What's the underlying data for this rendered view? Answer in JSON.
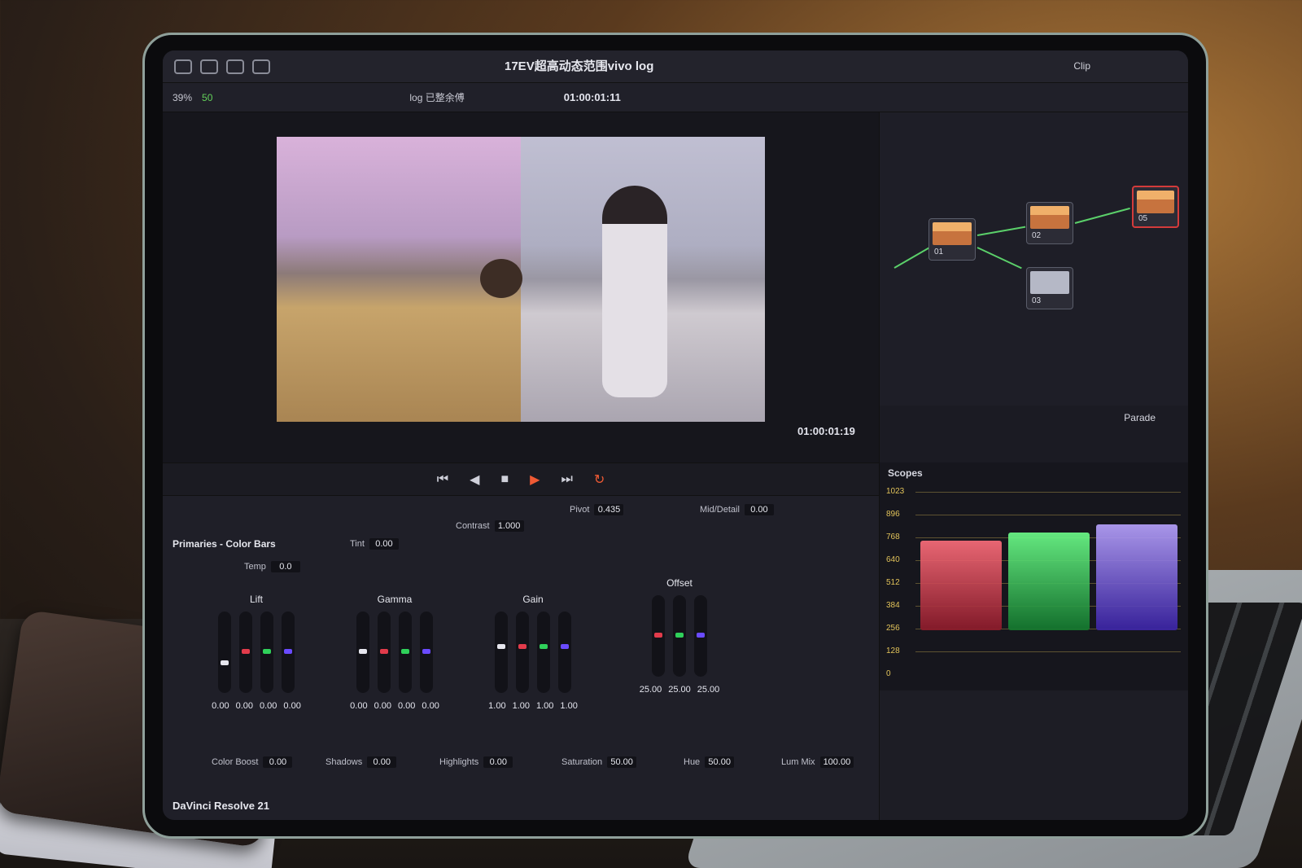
{
  "app": {
    "title": "17EV超高动态范围vivo log",
    "clip_menu": "Clip",
    "brand": "DaVinci Resolve 21"
  },
  "viewer": {
    "zoom": "39%",
    "field_value": "50",
    "clip_name": "log 已整余傅",
    "timecode_top": "01:00:01:11",
    "timecode_bottom": "01:00:01:19"
  },
  "nodes": {
    "items": [
      {
        "label": "01"
      },
      {
        "label": "02"
      },
      {
        "label": "03"
      },
      {
        "label": "05"
      }
    ],
    "scope_mode": "Parade"
  },
  "scopes": {
    "title": "Scopes",
    "scale": [
      "1023",
      "896",
      "768",
      "640",
      "512",
      "384",
      "256",
      "128",
      "0"
    ]
  },
  "primaries": {
    "title": "Primaries - Color Bars",
    "temp_label": "Temp",
    "temp": "0.0",
    "tint_label": "Tint",
    "tint": "0.00",
    "contrast_label": "Contrast",
    "contrast": "1.000",
    "pivot_label": "Pivot",
    "pivot": "0.435",
    "middetail_label": "Mid/Detail",
    "middetail": "0.00",
    "lift": {
      "title": "Lift",
      "values": [
        "0.00",
        "0.00",
        "0.00",
        "0.00"
      ]
    },
    "gamma": {
      "title": "Gamma",
      "values": [
        "0.00",
        "0.00",
        "0.00",
        "0.00"
      ]
    },
    "gain": {
      "title": "Gain",
      "values": [
        "1.00",
        "1.00",
        "1.00",
        "1.00"
      ]
    },
    "offset": {
      "title": "Offset",
      "values": [
        "25.00",
        "25.00",
        "25.00"
      ]
    },
    "color_boost_label": "Color Boost",
    "color_boost": "0.00",
    "shadows_label": "Shadows",
    "shadows": "0.00",
    "highlights_label": "Highlights",
    "highlights": "0.00",
    "saturation_label": "Saturation",
    "saturation": "50.00",
    "hue_label": "Hue",
    "hue": "50.00",
    "lummix_label": "Lum Mix",
    "lummix": "100.00"
  },
  "colors": {
    "accent": "#f05a34",
    "node_link": "#5bd06a",
    "scope_red": "#e23b4b",
    "scope_green": "#2fd05a",
    "scope_blue": "#6a4bff"
  }
}
